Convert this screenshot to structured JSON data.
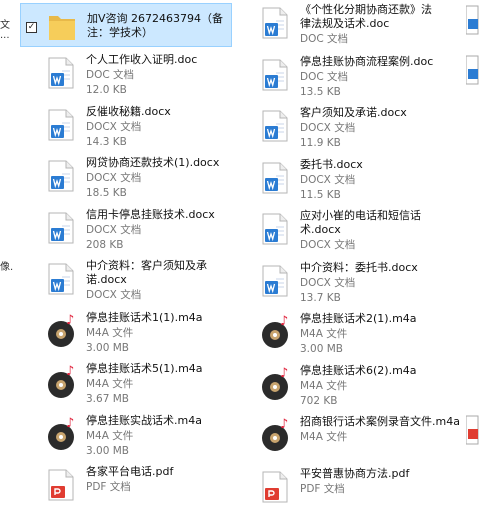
{
  "left_fragments": [
    {
      "text": "文"
    },
    {
      "text": "..."
    },
    {
      "text": "像."
    }
  ],
  "selected_item": {
    "name": "加V咨询 2672463794（备注：学技术）",
    "checked": "✓"
  },
  "left_column": [
    {
      "name": "个人工作收入证明.doc",
      "type": "DOC 文档",
      "size": "12.0 KB",
      "kind": "doc"
    },
    {
      "name": "反催收秘籍.docx",
      "type": "DOCX 文档",
      "size": "14.3 KB",
      "kind": "doc"
    },
    {
      "name": "网贷协商还款技术(1).docx",
      "type": "DOCX 文档",
      "size": "18.5 KB",
      "kind": "doc"
    },
    {
      "name": "信用卡停息挂账技术.docx",
      "type": "DOCX 文档",
      "size": "208 KB",
      "kind": "doc"
    },
    {
      "name": "中介资料：客户须知及承诺.docx",
      "type": "DOCX 文档",
      "size": "",
      "kind": "doc"
    },
    {
      "name": "停息挂账话术1(1).m4a",
      "type": "M4A 文件",
      "size": "3.00 MB",
      "kind": "m4a"
    },
    {
      "name": "停息挂账话术5(1).m4a",
      "type": "M4A 文件",
      "size": "3.67 MB",
      "kind": "m4a"
    },
    {
      "name": "停息挂账实战话术.m4a",
      "type": "M4A 文件",
      "size": "3.00 MB",
      "kind": "m4a"
    },
    {
      "name": "各家平台电话.pdf",
      "type": "PDF 文档",
      "size": "",
      "kind": "pdf"
    }
  ],
  "right_column": [
    {
      "name": "《个性化分期协商还款》法律法规及话术.doc",
      "type": "DOC 文档",
      "size": "",
      "kind": "doc"
    },
    {
      "name": "停息挂账协商流程案例.doc",
      "type": "DOC 文档",
      "size": "13.5 KB",
      "kind": "doc"
    },
    {
      "name": "客户须知及承诺.docx",
      "type": "DOCX 文档",
      "size": "11.9 KB",
      "kind": "doc"
    },
    {
      "name": "委托书.docx",
      "type": "DOCX 文档",
      "size": "11.5 KB",
      "kind": "doc"
    },
    {
      "name": "应对小崔的电话和短信话术.docx",
      "type": "DOCX 文档",
      "size": "",
      "kind": "doc"
    },
    {
      "name": "中介资料：委托书.docx",
      "type": "DOCX 文档",
      "size": "13.7 KB",
      "kind": "doc"
    },
    {
      "name": "停息挂账话术2(1).m4a",
      "type": "M4A 文件",
      "size": "3.00 MB",
      "kind": "m4a"
    },
    {
      "name": "停息挂账话术6(2).m4a",
      "type": "M4A 文件",
      "size": "702 KB",
      "kind": "m4a"
    },
    {
      "name": "招商银行话术案例录音文件.m4a",
      "type": "M4A 文件",
      "size": "",
      "kind": "m4a"
    },
    {
      "name": "平安普惠协商方法.pdf",
      "type": "PDF 文档",
      "size": "",
      "kind": "pdf"
    }
  ]
}
